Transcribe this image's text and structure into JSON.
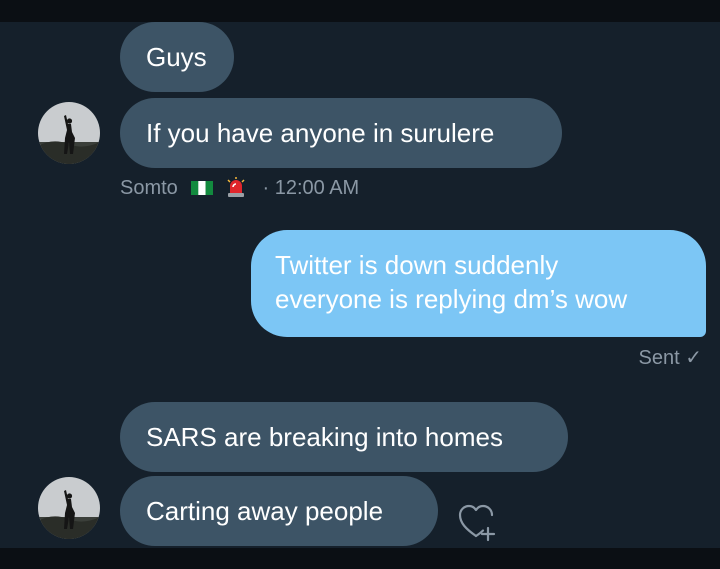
{
  "conversation": {
    "group1": {
      "messages": [
        "Guys",
        "If you have anyone in surulere"
      ],
      "sender": "Somto",
      "sender_flag_icon": "nigeria-flag-icon",
      "sender_badge_icon": "siren-emoji-icon",
      "time": "· 12:00 AM"
    },
    "sent": {
      "line1": "Twitter is down suddenly",
      "line2": "everyone is replying dm’s wow",
      "status": "Sent ✓"
    },
    "group2": {
      "messages": [
        "SARS are breaking into homes",
        "Carting away people"
      ],
      "react_icon": "heart-plus-icon"
    }
  },
  "colors": {
    "background": "#15202b",
    "incoming_bubble": "#3d5466",
    "outgoing_bubble": "#7cc6f5",
    "meta_text": "#8b98a5"
  }
}
